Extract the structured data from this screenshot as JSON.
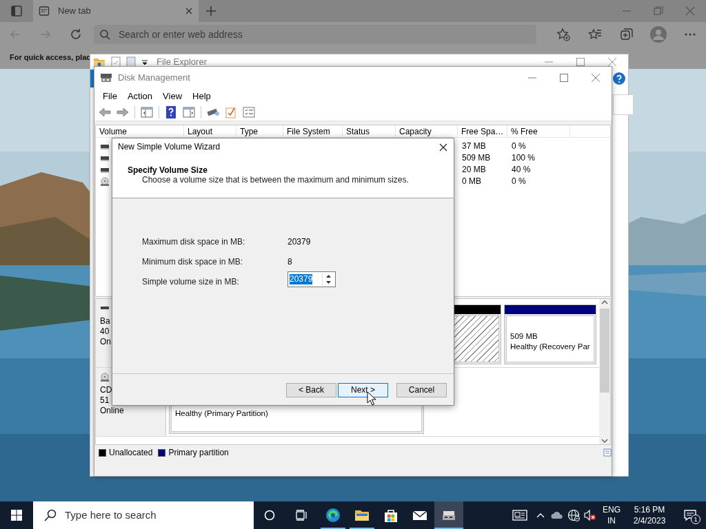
{
  "browser": {
    "tab": {
      "label": "New tab",
      "selected": true
    },
    "address_bar": {
      "placeholder": "Search or enter web address"
    },
    "favorites_hint": "For quick access, plac"
  },
  "file_explorer": {
    "title": "File Explorer"
  },
  "disk_management": {
    "title": "Disk Management",
    "menu": [
      "File",
      "Action",
      "View",
      "Help"
    ],
    "columns": [
      "Volume",
      "Layout",
      "Type",
      "File System",
      "Status",
      "Capacity",
      "Free Spa…",
      "% Free"
    ],
    "volumes": [
      {
        "kind": "disk",
        "free_space": "37 MB",
        "percent_free": "0 %"
      },
      {
        "kind": "disk",
        "free_space": "509 MB",
        "percent_free": "100 %"
      },
      {
        "kind": "disk",
        "free_space": "20 MB",
        "percent_free": "40 %"
      },
      {
        "kind": "cdrom",
        "free_space": "0 MB",
        "percent_free": "0 %"
      }
    ],
    "disks": [
      {
        "kind": "disk",
        "info": [
          "Ba",
          "40",
          "On"
        ],
        "partitions": [
          {
            "kind": "unallocated"
          },
          {
            "kind": "primary",
            "size": "509 MB",
            "status": "Healthy (Recovery Par"
          }
        ]
      },
      {
        "kind": "cdrom",
        "info": [
          "CD",
          "51",
          "Online"
        ],
        "partitions": [
          {
            "kind": "primary",
            "status": "Healthy (Primary Partition)"
          }
        ]
      }
    ],
    "legend": [
      {
        "label": "Unallocated",
        "color": "#000000"
      },
      {
        "label": "Primary partition",
        "color": "#00007f"
      }
    ]
  },
  "wizard": {
    "title": "New Simple Volume Wizard",
    "heading": "Specify Volume Size",
    "subtitle": "Choose a volume size that is between the maximum and minimum sizes.",
    "facts": [
      {
        "label": "Maximum disk space in MB:",
        "value": "20379"
      },
      {
        "label": "Minimum disk space in MB:",
        "value": "8"
      }
    ],
    "size_field": {
      "label": "Simple volume size in MB:",
      "value": "20379",
      "text_selected": true
    },
    "buttons": [
      {
        "label": "< Back",
        "hovered": false
      },
      {
        "label": "Next >",
        "hovered": true
      },
      {
        "label": "Cancel",
        "hovered": false
      }
    ]
  },
  "taskbar": {
    "search": {
      "placeholder": "Type here to search"
    },
    "apps": [
      {
        "kind": "edge",
        "running": true,
        "active": false
      },
      {
        "kind": "explorer",
        "running": true,
        "active": false
      },
      {
        "kind": "store",
        "running": false,
        "active": false
      },
      {
        "kind": "mail",
        "running": false,
        "active": false
      },
      {
        "kind": "disk-management",
        "running": true,
        "active": true
      }
    ],
    "language": "ENG",
    "region": "IN",
    "time": "5:16 PM",
    "date": "2/4/2023",
    "notification_count": "1",
    "volume_muted": true
  }
}
